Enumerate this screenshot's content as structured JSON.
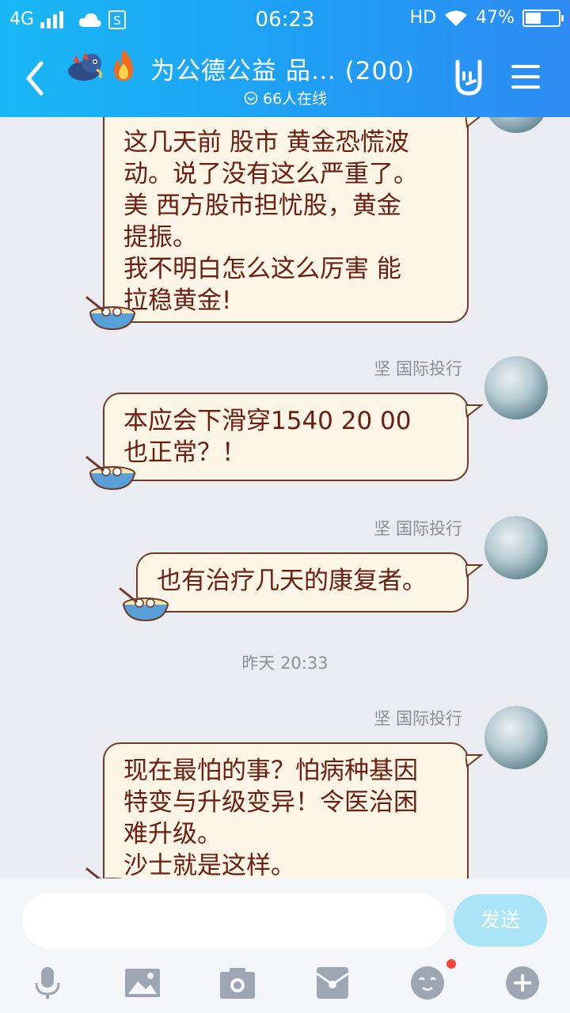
{
  "status_bar": {
    "network": "4G",
    "time": "06:23",
    "hd": "HD",
    "battery_text": "47%",
    "battery_level": 0.47
  },
  "header": {
    "title": "为公德公益  品… (200)",
    "online": "66人在线"
  },
  "messages": [
    {
      "sender": "",
      "text": "这几天前 股市 黄金恐慌波\n动。说了没有这么严重了。\n美 西方股市担忧股，黄金\n提振。\n我不明白怎么这么厉害  能\n拉稳黄金!"
    },
    {
      "sender": "坚 国际投行",
      "text": "本应会下滑穿1540  20  00\n也正常？！"
    },
    {
      "sender": "坚 国际投行",
      "text": "也有治疗几天的康复者。"
    },
    {
      "sender": "坚 国际投行",
      "text": "现在最怕的事？怕病种基因\n特变与升级变异！令医治困\n难升级。\n沙士就是这样。"
    }
  ],
  "timestamp": "昨天 20:33",
  "input": {
    "placeholder": "",
    "send_label": "发送"
  },
  "colors": {
    "header_start": "#19b8f5",
    "header_end": "#2e8cf3",
    "bubble_bg": "#fdf6e6",
    "bubble_text": "#6a1d10",
    "send_button": "#a9e4f7",
    "toolbar_icon": "#9ea6b4"
  },
  "toolbar_icons": [
    "microphone-icon",
    "image-icon",
    "camera-icon",
    "red-packet-icon",
    "emoji-icon",
    "plus-icon"
  ]
}
